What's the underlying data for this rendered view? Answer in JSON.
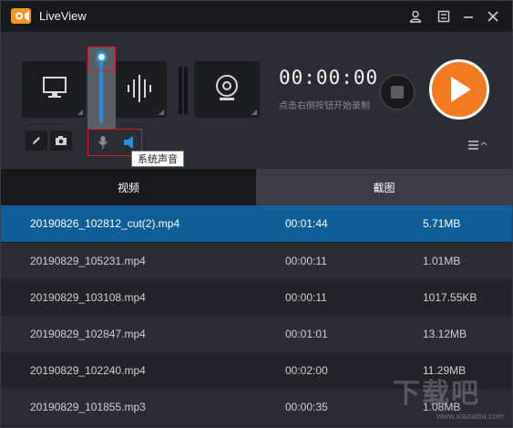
{
  "app": {
    "title": "LiveView"
  },
  "titlebar": {
    "icons": [
      "user-icon",
      "settings-icon",
      "minimize-icon",
      "close-icon"
    ]
  },
  "recorder": {
    "timer": "00:00:00",
    "hint": "点击右侧按钮开始录制",
    "tooltip": "系统声音",
    "sources": [
      "monitor-icon",
      "audio-wave-icon",
      "webcam-icon"
    ],
    "volume_level": 1.0
  },
  "tabs": [
    {
      "label": "视频",
      "active": true
    },
    {
      "label": "截图",
      "active": false
    }
  ],
  "files": [
    {
      "name": "20190826_102812_cut(2).mp4",
      "duration": "00:01:44",
      "size": "5.71MB",
      "selected": true
    },
    {
      "name": "20190829_105231.mp4",
      "duration": "00:00:11",
      "size": "1.01MB"
    },
    {
      "name": "20190829_103108.mp4",
      "duration": "00:00:11",
      "size": "1017.55KB"
    },
    {
      "name": "20190829_102847.mp4",
      "duration": "00:01:01",
      "size": "13.12MB"
    },
    {
      "name": "20190829_102240.mp4",
      "duration": "00:02:00",
      "size": "11.29MB"
    },
    {
      "name": "20190829_101855.mp3",
      "duration": "00:00:35",
      "size": "1.08MB"
    }
  ],
  "watermark": {
    "text": "下载吧",
    "url": "www.xiazaiba.com"
  },
  "colors": {
    "accent": "#f27b22",
    "selection": "#0f5e98",
    "slider": "#2f8cd8"
  }
}
